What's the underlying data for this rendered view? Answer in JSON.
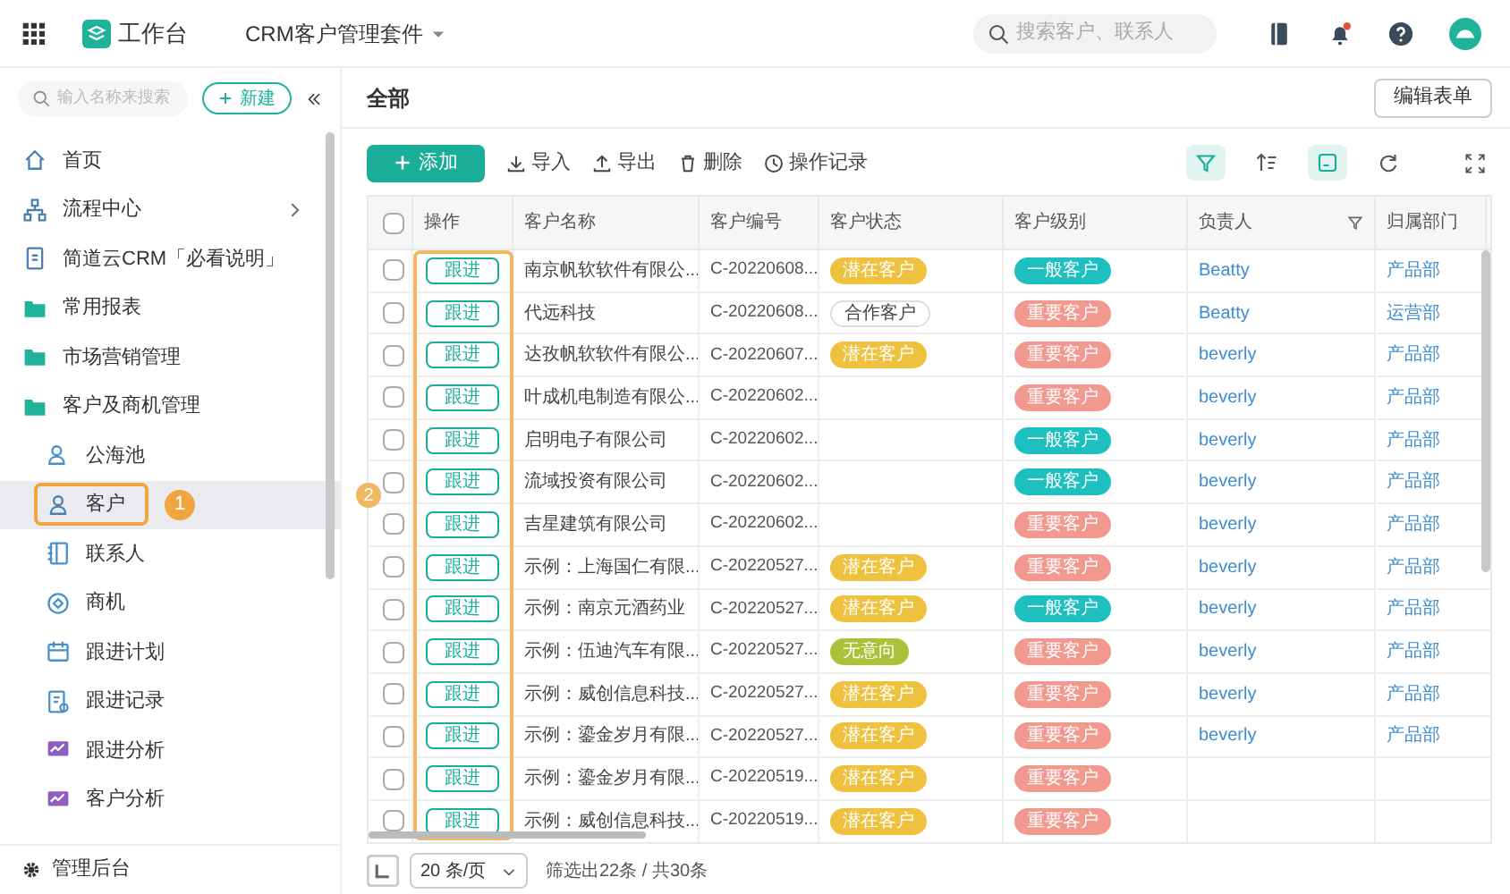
{
  "topbar": {
    "home": "工作台",
    "app": "CRM客户管理套件",
    "search_placeholder": "搜索客户、联系人",
    "notification_dot": true
  },
  "sidebar": {
    "search_placeholder": "输入名称来搜索",
    "new_button": "新建",
    "items": [
      {
        "label": "首页",
        "selected": false
      },
      {
        "label": "流程中心",
        "selected": false,
        "expanded": false
      },
      {
        "label": "简道云CRM「必看说明」",
        "selected": false
      },
      {
        "label": "常用报表",
        "selected": false
      },
      {
        "label": "市场营销管理",
        "selected": false
      },
      {
        "label": "客户及商机管理",
        "selected": false,
        "children": [
          {
            "label": "公海池",
            "selected": false
          },
          {
            "label": "客户",
            "selected": true,
            "callout": "1"
          },
          {
            "label": "联系人",
            "selected": false
          },
          {
            "label": "商机",
            "selected": false
          },
          {
            "label": "跟进计划",
            "selected": false
          },
          {
            "label": "跟进记录",
            "selected": false
          },
          {
            "label": "跟进分析",
            "selected": false
          },
          {
            "label": "客户分析",
            "selected": false
          }
        ]
      }
    ],
    "footer": "管理后台"
  },
  "header": {
    "title": "全部",
    "edit_button": "编辑表单"
  },
  "toolbar": {
    "add": "添加",
    "actions": [
      "导入",
      "导出",
      "删除",
      "操作记录"
    ]
  },
  "table": {
    "select_all_checked": false,
    "columns": [
      "操作",
      "客户名称",
      "客户编号",
      "客户状态",
      "客户级别",
      "负责人",
      "归属部门"
    ],
    "action_callout": "2",
    "rows": [
      {
        "checked": false,
        "action": "跟进",
        "name": "南京帆软软件有限公...",
        "code": "C-20220608...",
        "status": {
          "text": "潜在客户",
          "kind": "filled",
          "color": "#eec23e"
        },
        "level": {
          "text": "一般客户",
          "kind": "filled",
          "color": "#1ebfbf"
        },
        "owner": "Beatty",
        "dept": "产品部"
      },
      {
        "checked": false,
        "action": "跟进",
        "name": "代远科技",
        "code": "C-20220608...",
        "status": {
          "text": "合作客户",
          "kind": "outline",
          "color": "#dddddd"
        },
        "level": {
          "text": "重要客户",
          "kind": "filled",
          "color": "#f2998f"
        },
        "owner": "Beatty",
        "dept": "运营部"
      },
      {
        "checked": false,
        "action": "跟进",
        "name": "达孜帆软软件有限公...",
        "code": "C-20220607...",
        "status": {
          "text": "潜在客户",
          "kind": "filled",
          "color": "#eec23e"
        },
        "level": {
          "text": "重要客户",
          "kind": "filled",
          "color": "#f2998f"
        },
        "owner": "beverly",
        "dept": "产品部"
      },
      {
        "checked": false,
        "action": "跟进",
        "name": "叶成机电制造有限公...",
        "code": "C-20220602...",
        "level": {
          "text": "重要客户",
          "kind": "filled",
          "color": "#f2998f"
        },
        "owner": "beverly",
        "dept": "产品部"
      },
      {
        "checked": false,
        "action": "跟进",
        "name": "启明电子有限公司",
        "code": "C-20220602...",
        "level": {
          "text": "一般客户",
          "kind": "filled",
          "color": "#1ebfbf"
        },
        "owner": "beverly",
        "dept": "产品部"
      },
      {
        "checked": false,
        "action": "跟进",
        "name": "流域投资有限公司",
        "code": "C-20220602...",
        "level": {
          "text": "一般客户",
          "kind": "filled",
          "color": "#1ebfbf"
        },
        "owner": "beverly",
        "dept": "产品部"
      },
      {
        "checked": false,
        "action": "跟进",
        "name": "吉星建筑有限公司",
        "code": "C-20220602...",
        "level": {
          "text": "重要客户",
          "kind": "filled",
          "color": "#f2998f"
        },
        "owner": "beverly",
        "dept": "产品部"
      },
      {
        "checked": false,
        "action": "跟进",
        "name": "示例：上海国仁有限...",
        "code": "C-20220527...",
        "status": {
          "text": "潜在客户",
          "kind": "filled",
          "color": "#eec23e"
        },
        "level": {
          "text": "重要客户",
          "kind": "filled",
          "color": "#f2998f"
        },
        "owner": "beverly",
        "dept": "产品部"
      },
      {
        "checked": false,
        "action": "跟进",
        "name": "示例：南京元酒药业",
        "code": "C-20220527...",
        "status": {
          "text": "潜在客户",
          "kind": "filled",
          "color": "#eec23e"
        },
        "level": {
          "text": "一般客户",
          "kind": "filled",
          "color": "#1ebfbf"
        },
        "owner": "beverly",
        "dept": "产品部"
      },
      {
        "checked": false,
        "action": "跟进",
        "name": "示例：伍迪汽车有限...",
        "code": "C-20220527...",
        "status": {
          "text": "无意向",
          "kind": "filled",
          "color": "#a9c23a"
        },
        "level": {
          "text": "重要客户",
          "kind": "filled",
          "color": "#f2998f"
        },
        "owner": "beverly",
        "dept": "产品部"
      },
      {
        "checked": false,
        "action": "跟进",
        "name": "示例：威创信息科技...",
        "code": "C-20220527...",
        "status": {
          "text": "潜在客户",
          "kind": "filled",
          "color": "#eec23e"
        },
        "level": {
          "text": "重要客户",
          "kind": "filled",
          "color": "#f2998f"
        },
        "owner": "beverly",
        "dept": "产品部"
      },
      {
        "checked": false,
        "action": "跟进",
        "name": "示例：鎏金岁月有限...",
        "code": "C-20220527...",
        "status": {
          "text": "潜在客户",
          "kind": "filled",
          "color": "#eec23e"
        },
        "level": {
          "text": "重要客户",
          "kind": "filled",
          "color": "#f2998f"
        },
        "owner": "beverly",
        "dept": "产品部"
      },
      {
        "checked": false,
        "action": "跟进",
        "name": "示例：鎏金岁月有限...",
        "code": "C-20220519...",
        "status": {
          "text": "潜在客户",
          "kind": "filled",
          "color": "#eec23e"
        },
        "level": {
          "text": "重要客户",
          "kind": "filled",
          "color": "#f2998f"
        }
      },
      {
        "checked": false,
        "action": "跟进",
        "name": "示例：威创信息科技...",
        "code": "C-20220519...",
        "status": {
          "text": "潜在客户",
          "kind": "filled",
          "color": "#eec23e"
        },
        "level": {
          "text": "重要客户",
          "kind": "filled",
          "color": "#f2998f"
        }
      }
    ]
  },
  "footer": {
    "page_size": "20 条/页",
    "summary": "筛选出22条 / 共30条"
  }
}
